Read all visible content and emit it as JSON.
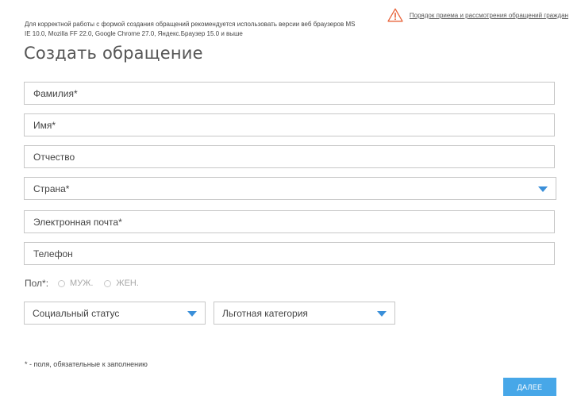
{
  "notice": {
    "browser_requirements": "Для корректной работы с формой создания обращений рекомендуется использовать версии веб браузеров MS IE 10.0, Mozilla FF 22.0, Google Chrome 27.0, Яндекс.Браузер 15.0 и выше",
    "procedure_link": "Порядок приема и рассмотрения обращений граждан",
    "icon": "warning-icon",
    "icon_color": "#e8633a"
  },
  "title": "Создать обращение",
  "fields": {
    "last_name": {
      "placeholder": "Фамилия*",
      "value": ""
    },
    "first_name": {
      "placeholder": "Имя*",
      "value": ""
    },
    "patronymic": {
      "placeholder": "Отчество",
      "value": ""
    },
    "country": {
      "placeholder": "Страна*",
      "value": ""
    },
    "email": {
      "placeholder": "Электронная почта*",
      "value": ""
    },
    "phone": {
      "placeholder": "Телефон",
      "value": ""
    }
  },
  "gender": {
    "label": "Пол*:",
    "options": [
      "МУЖ.",
      "ЖЕН."
    ]
  },
  "social_status": {
    "placeholder": "Социальный статус"
  },
  "benefit_category": {
    "placeholder": "Льготная категория"
  },
  "required_note": "* - поля, обязательные к заполнению",
  "next_button": "ДАЛЕЕ",
  "colors": {
    "accent": "#47a7e8",
    "dropdown_arrow": "#3a8fd9",
    "border": "#c7c7c7"
  }
}
